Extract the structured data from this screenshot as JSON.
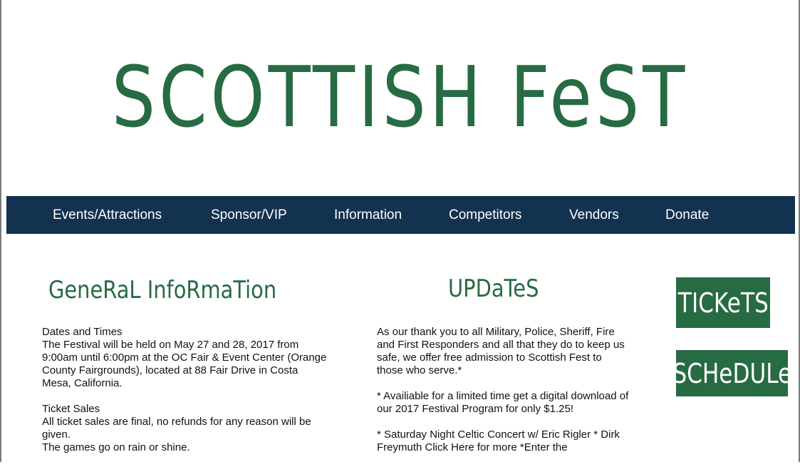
{
  "header": {
    "title": "SCOTTISH FeST"
  },
  "nav": {
    "items": [
      {
        "label": "Events/Attractions"
      },
      {
        "label": "Sponsor/VIP"
      },
      {
        "label": "Information"
      },
      {
        "label": "Competitors"
      },
      {
        "label": "Vendors"
      },
      {
        "label": "Donate"
      }
    ]
  },
  "general": {
    "heading": "GeneRaL InfoRmaTion",
    "dates_title": "Dates and Times",
    "dates_text": "The Festival will be held on May 27 and 28, 2017 from 9:00am until 6:00pm at the OC Fair & Event Center (Orange County Fairgrounds), located at 88 Fair Drive in Costa Mesa, California.",
    "tickets_title": "Ticket Sales",
    "tickets_text": "All ticket sales are final, no refunds for any reason will be given.",
    "weather_text": "The games go on rain or shine."
  },
  "updates": {
    "heading": "UPDaTeS",
    "p1": "As our thank you to all Military, Police, Sheriff, Fire and First Responders and all that they do to keep us safe, we offer free admission to Scottish Fest to those who serve.*",
    "p2": "* Availiable for a limited time get a digital download of our 2017 Festival Program for only $1.25!",
    "p3": "* Saturday Night Celtic Concert w/ Eric Rigler * Dirk Freymuth Click Here for more *Enter the"
  },
  "sidebar": {
    "tickets_label": "TICKeTS",
    "schedule_label": "SCHeDULe"
  },
  "colors": {
    "brand_green": "#276b43",
    "nav_navy": "#123250"
  }
}
